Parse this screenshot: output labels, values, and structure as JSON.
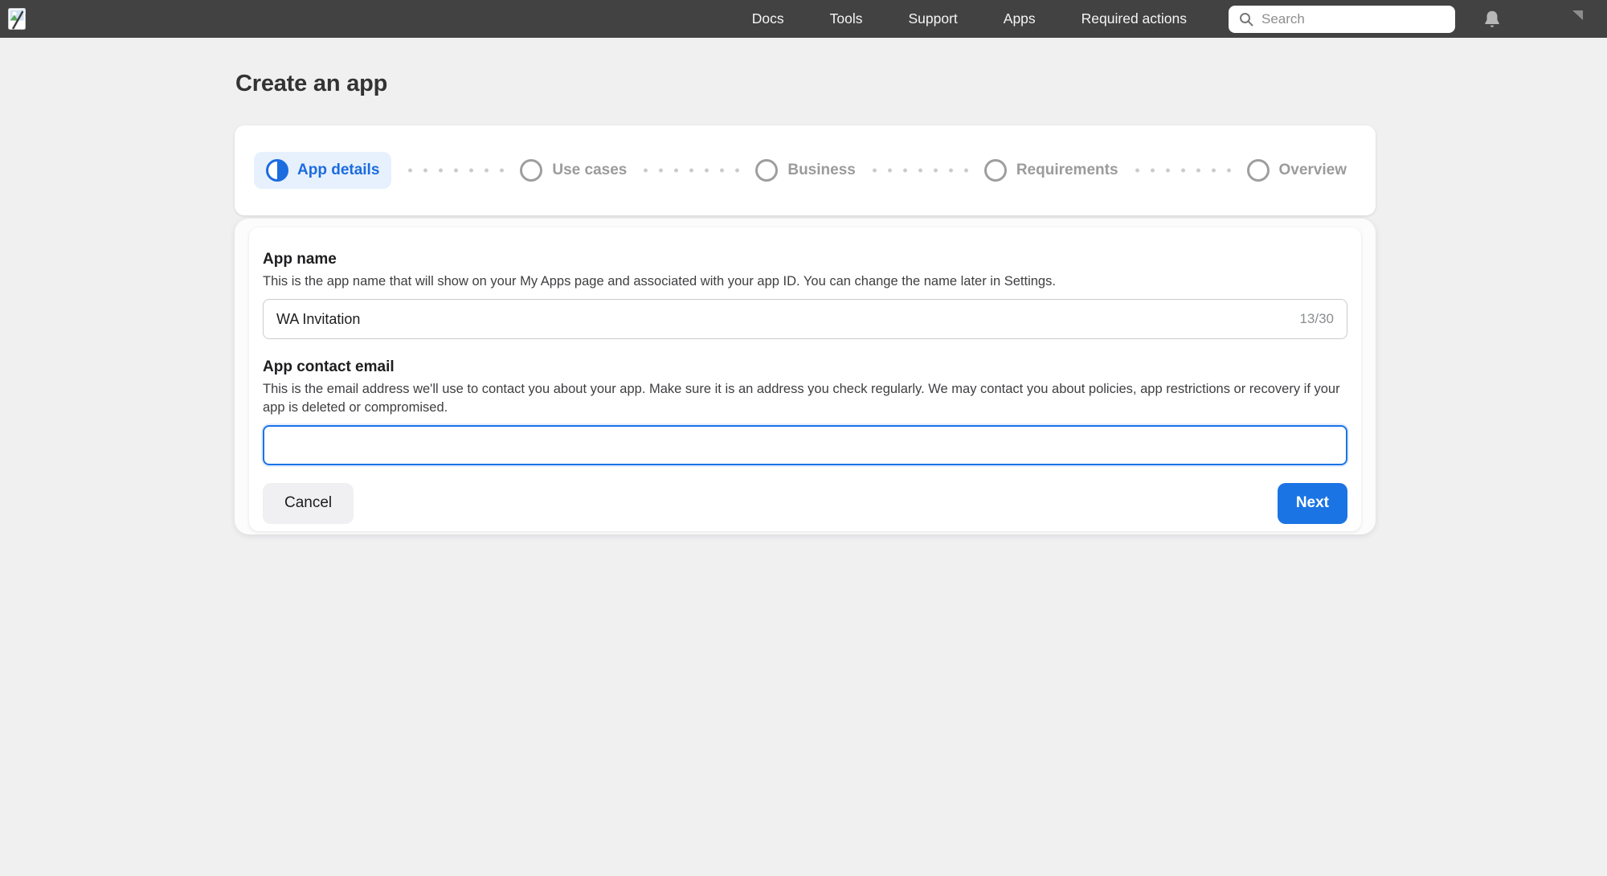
{
  "nav": {
    "links": [
      {
        "label": "Docs"
      },
      {
        "label": "Tools"
      },
      {
        "label": "Support"
      },
      {
        "label": "Apps"
      },
      {
        "label": "Required actions"
      }
    ],
    "search": {
      "placeholder": "Search"
    },
    "icons": {
      "logo": "broken-image",
      "search": "magnifier",
      "bell": "notification-bell",
      "corner": "gray-corner-triangle"
    }
  },
  "page": {
    "title": "Create an app"
  },
  "stepper": {
    "steps": [
      {
        "label": "App details",
        "state": "active"
      },
      {
        "label": "Use cases",
        "state": "upcoming"
      },
      {
        "label": "Business",
        "state": "upcoming"
      },
      {
        "label": "Requirements",
        "state": "upcoming"
      },
      {
        "label": "Overview",
        "state": "upcoming"
      }
    ]
  },
  "form": {
    "app_name": {
      "label": "App name",
      "description": "This is the app name that will show on your My Apps page and associated with your app ID. You can change the name later in Settings.",
      "value": "WA Invitation",
      "counter": "13/30"
    },
    "app_email": {
      "label": "App contact email",
      "description": "This is the email address we'll use to contact you about your app. Make sure it is an address you check regularly. We may contact you about policies, app restrictions or recovery if your app is deleted or compromised.",
      "value": ""
    },
    "cancel_label": "Cancel",
    "next_label": "Next"
  },
  "colors": {
    "accent_blue": "#1b74e4",
    "active_step_blue": "#1b6cdf",
    "active_step_bg": "#e7f0fd",
    "nav_bg": "#424242",
    "page_bg": "#f0f0f1",
    "inactive_gray": "#9b9b9b"
  }
}
